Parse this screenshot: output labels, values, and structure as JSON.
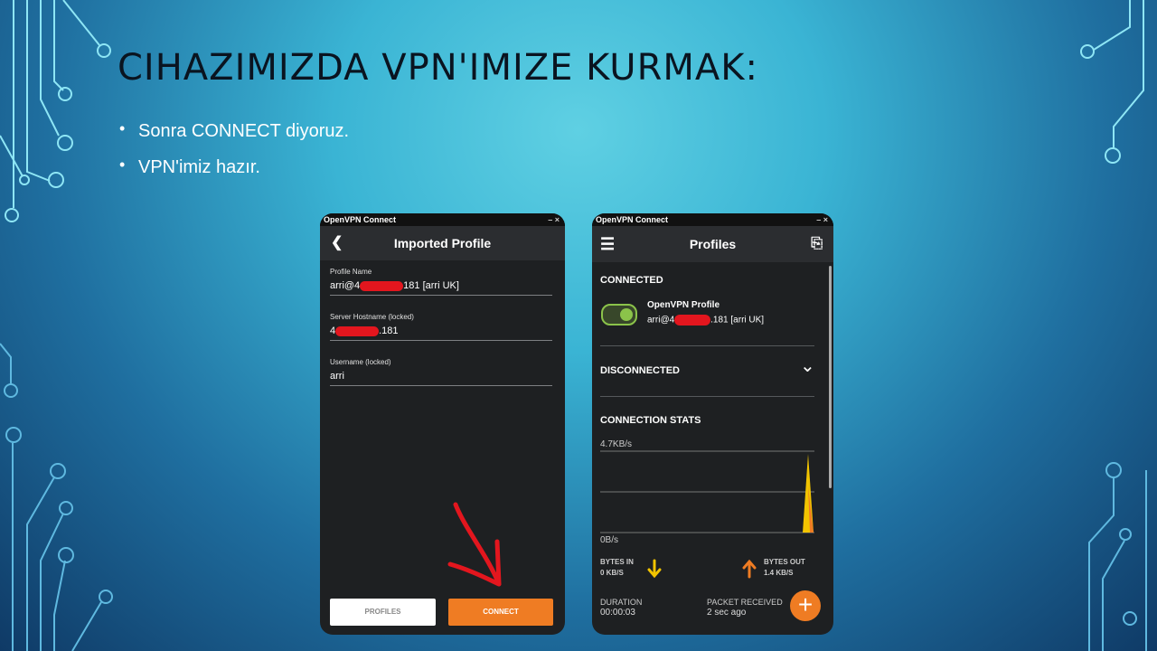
{
  "slide": {
    "title": "CIHAZIMIZDA VPN'IMIZE KURMAK:",
    "bullets": [
      "Sonra CONNECT diyoruz.",
      "VPN'imiz hazır."
    ]
  },
  "left_phone": {
    "app_title": "OpenVPN Connect",
    "window_controls": "– ×",
    "back_icon": "❮",
    "header": "Imported Profile",
    "fields": [
      {
        "label": "Profile Name",
        "value_prefix": "arri@4",
        "value_suffix": "181 [arri UK]"
      },
      {
        "label": "Server Hostname (locked)",
        "value_prefix": "4",
        "value_suffix": ".181"
      },
      {
        "label": "Username (locked)",
        "value": "arri"
      }
    ],
    "buttons": {
      "profiles": "PROFILES",
      "connect": "CONNECT"
    }
  },
  "right_phone": {
    "app_title": "OpenVPN Connect",
    "window_controls": "– ×",
    "menu_icon": "☰",
    "header": "Profiles",
    "import_icon": "⎘",
    "connected_heading": "CONNECTED",
    "profile": {
      "name": "OpenVPN Profile",
      "detail_prefix": "arri@4",
      "detail_suffix": ".181 [arri UK]"
    },
    "disconnected_heading": "DISCONNECTED",
    "chevron_icon": "⌄",
    "stats_heading": "CONNECTION STATS",
    "chart_max": "4.7KB/s",
    "chart_min": "0B/s",
    "bytes_in": {
      "label": "BYTES IN",
      "value": "0 KB/S"
    },
    "bytes_out": {
      "label": "BYTES OUT",
      "value": "1.4 KB/S"
    },
    "duration": {
      "label": "DURATION",
      "value": "00:00:03"
    },
    "packet": {
      "label": "PACKET RECEIVED",
      "value": "2 sec ago"
    },
    "fab_icon": "+"
  },
  "colors": {
    "accent": "#ef7c23",
    "toggle": "#8bc34a",
    "redact": "#e3161e",
    "spike": "#f2c400"
  }
}
